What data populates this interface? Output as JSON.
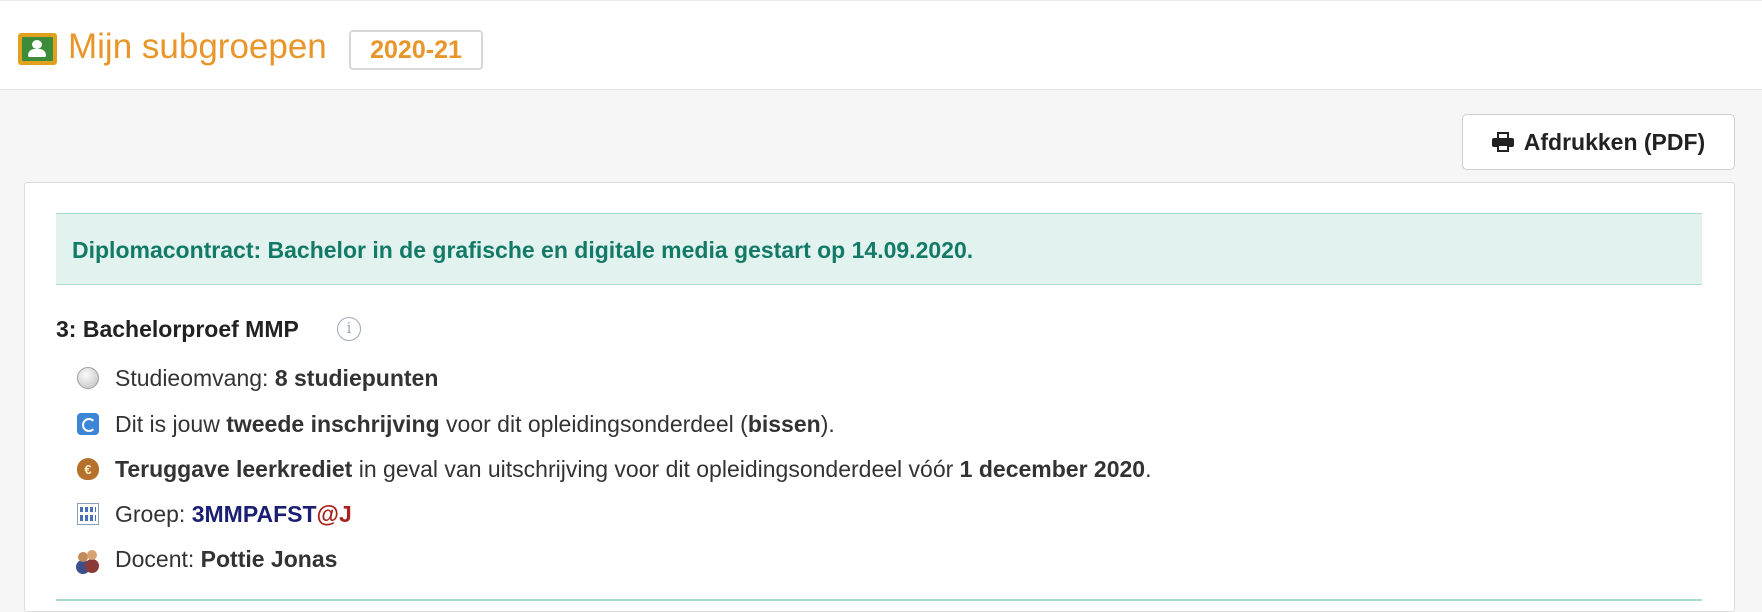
{
  "header": {
    "title": "Mijn subgroepen",
    "academic_year": "2020-21",
    "icon": "classroom-icon"
  },
  "toolbar": {
    "print_label": "Afdrukken (PDF)",
    "print_icon": "printer-icon"
  },
  "alert": {
    "text": "Diplomacontract: Bachelor in de grafische en digitale media gestart op 14.09.2020.",
    "color": "#127a66"
  },
  "course": {
    "title": "3: Bachelorproef MMP",
    "info_icon": "i",
    "facts": {
      "study_load": {
        "prefix": "Studieomvang: ",
        "value": "8 studiepunten"
      },
      "enrollment": {
        "prefix": "Dit is jouw ",
        "strong": "tweede inschrijving",
        "middle": " voor dit opleidingsonderdeel (",
        "strong2": "bissen",
        "suffix": ")."
      },
      "refund": {
        "strong": "Teruggave leerkrediet",
        "middle": " in geval van uitschrijving voor dit opleidingsonderdeel vóór ",
        "date": "1 december 2020",
        "suffix": "."
      },
      "group": {
        "prefix": "Groep: ",
        "code": "3MMPAFST",
        "suffix": "@J"
      },
      "teacher": {
        "prefix": "Docent: ",
        "name": "Pottie Jonas"
      }
    }
  }
}
